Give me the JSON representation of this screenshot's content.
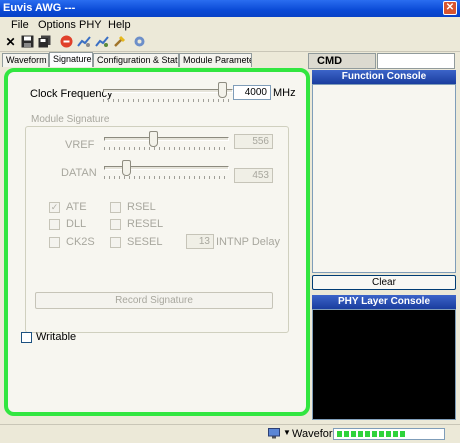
{
  "window": {
    "title": "Euvis AWG ---"
  },
  "menu": [
    "File",
    "Options",
    "PHY",
    "Help"
  ],
  "toolbar_icons": [
    "close-x-icon",
    "save-icon",
    "save-all-icon",
    "stop-icon",
    "connect-icon",
    "disconnect-icon",
    "tool-icon",
    "gear-icon"
  ],
  "tabs": [
    "Waveform",
    "Signature",
    "Configuration & Status",
    "Module Parameter"
  ],
  "active_tab": "Signature",
  "clock": {
    "label": "Clock Frequency",
    "value": "4000",
    "unit": "MHz",
    "slider_fraction": 1.0
  },
  "module_signature": {
    "title": "Module Signature",
    "vref": {
      "label": "VREF",
      "value": "556",
      "slider_fraction": 0.44
    },
    "datan": {
      "label": "DATAN",
      "value": "453",
      "slider_fraction": 0.35
    },
    "checks": [
      {
        "label": "ATE",
        "checked": true
      },
      {
        "label": "RSEL",
        "checked": false
      },
      {
        "label": "DLL",
        "checked": false
      },
      {
        "label": "RESEL",
        "checked": false
      },
      {
        "label": "CK2S",
        "checked": false
      },
      {
        "label": "SESEL",
        "checked": false
      }
    ],
    "intnp_value": "13",
    "intnp_label": "INTNP Delay",
    "record_button": "Record Signature"
  },
  "writable": {
    "label": "Writable",
    "checked": false
  },
  "cmd": {
    "tab_label": "CMD"
  },
  "function_console": {
    "title": "Function Console",
    "clear_label": "Clear"
  },
  "phy_console": {
    "title": "PHY Layer Console"
  },
  "status": {
    "waveform_label": "Waveform",
    "progress_fraction": 0.62
  },
  "colors": {
    "highlight": "#32e640",
    "console_header": "#1a3d9e",
    "progress": "#2fd33a"
  }
}
